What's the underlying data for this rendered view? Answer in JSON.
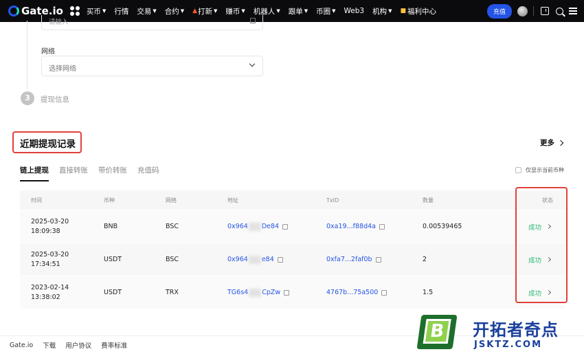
{
  "nav": {
    "brand": "Gate.io",
    "items": [
      {
        "label": "买币",
        "caret": true
      },
      {
        "label": "行情",
        "caret": false
      },
      {
        "label": "交易",
        "caret": true
      },
      {
        "label": "合约",
        "caret": true
      },
      {
        "label": "打新",
        "caret": true,
        "icon": "flame-icon"
      },
      {
        "label": "赚币",
        "caret": true
      },
      {
        "label": "机器人",
        "caret": true
      },
      {
        "label": "跟单",
        "caret": true
      },
      {
        "label": "币圈",
        "caret": true
      },
      {
        "label": "Web3",
        "caret": false
      },
      {
        "label": "机构",
        "caret": true
      },
      {
        "label": "福利中心",
        "caret": false,
        "icon": "gift-icon"
      }
    ],
    "deposit_label": "充值"
  },
  "form": {
    "address_placeholder": "请输入",
    "network_label": "网络",
    "network_placeholder": "选择网络",
    "step_number": "3",
    "step_label": "提现信息"
  },
  "records": {
    "title": "近期提现记录",
    "more_label": "更多",
    "tabs": [
      "链上提现",
      "直接转账",
      "带价转账",
      "充值码"
    ],
    "only_current_label": "仅显示当前币种",
    "columns": {
      "time": "时间",
      "coin": "币种",
      "network": "网络",
      "address": "地址",
      "txid": "TxID",
      "amount": "数量",
      "status": "状态"
    },
    "rows": [
      {
        "date": "2025-03-20",
        "clock": "18:09:38",
        "coin": "BNB",
        "network": "BSC",
        "addr_start": "0x964",
        "addr_end": "De84",
        "txid": "0xa19...f88d4a",
        "amount": "0.00539465",
        "status": "成功"
      },
      {
        "date": "2025-03-20",
        "clock": "17:34:51",
        "coin": "USDT",
        "network": "BSC",
        "addr_start": "0x964",
        "addr_end": "e84",
        "txid": "0xfa7...2faf0b",
        "amount": "2",
        "status": "成功"
      },
      {
        "date": "2023-02-14",
        "clock": "13:38:02",
        "coin": "USDT",
        "network": "TRX",
        "addr_start": "TG6s4",
        "addr_end": "CpZw",
        "txid": "4767b...75a500",
        "amount": "1.5",
        "status": "成功"
      }
    ]
  },
  "footer": {
    "links": [
      "Gate.io",
      "下载",
      "用户协议",
      "费率标准"
    ]
  },
  "watermark": {
    "badge_letter": "B",
    "title": "开拓者奇点",
    "subtitle": "JSKTZ.COM"
  },
  "colors": {
    "brand_blue": "#2354e6",
    "success_green": "#2bb673",
    "highlight_red": "#e0403a",
    "nav_bg": "#0b0b0e"
  }
}
